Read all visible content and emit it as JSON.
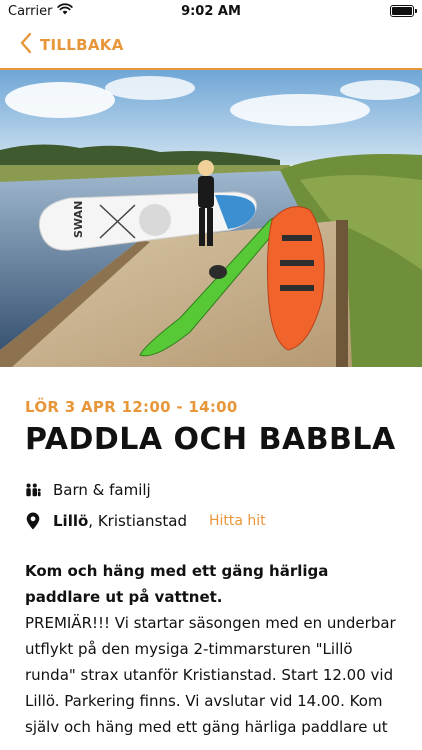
{
  "status_bar": {
    "carrier": "Carrier",
    "time": "9:02 AM",
    "battery_level": 1.0
  },
  "nav": {
    "back_label": "TILLBAKA",
    "back_icon": "chevron-left-icon"
  },
  "hero": {
    "board_brand": "SWAN"
  },
  "event": {
    "date": "LÖR 3 APR 12:00 - 14:00",
    "title": "PADDLA OCH BABBLA",
    "category_icon": "family-icon",
    "category": "Barn & familj",
    "location_icon": "map-pin-icon",
    "place": "Lillö",
    "city": ", Kristianstad",
    "directions_label": "Hitta hit",
    "description_lead": "Kom och häng med ett gäng härliga paddlare ut på vattnet.",
    "description_body": "PREMIÄR!!! Vi startar säsongen med en underbar utflykt på den mysiga 2-timmarsturen \"Lillö runda\" strax utanför Kristianstad. Start 12.00 vid Lillö. Parkering finns. Vi avslutar vid 14.00. Kom själv och häng med ett gäng härliga paddlare ut"
  },
  "colors": {
    "accent": "#e8963a",
    "text": "#111111"
  }
}
